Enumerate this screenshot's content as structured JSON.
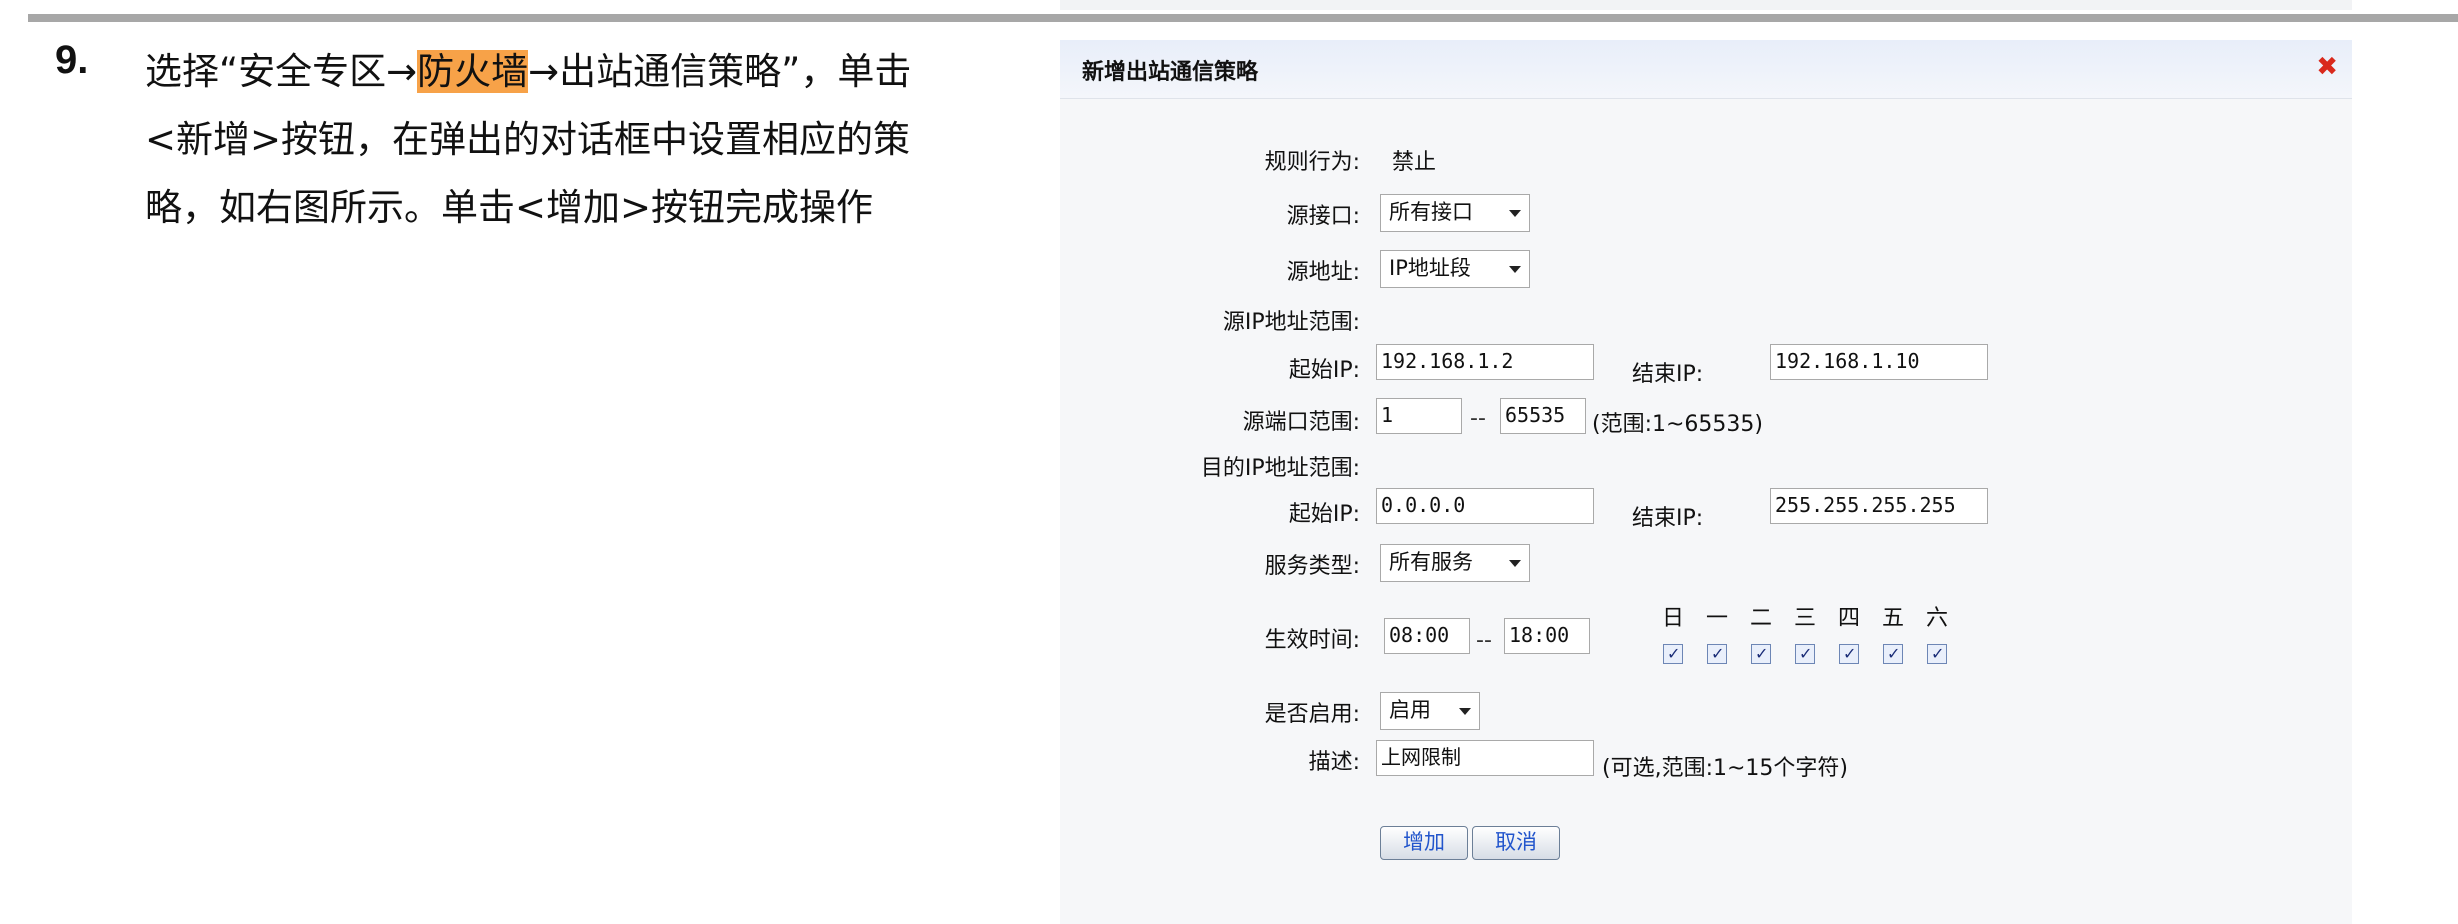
{
  "instruction": {
    "step_number": "9.",
    "line1_before": "选择“安全专区→",
    "line1_highlight": "防火墙",
    "line1_after": "→出站通信策略”，单击",
    "line2": "<新增>按钮，在弹出的对话框中设置相应的策",
    "line3": "略，如右图所示。单击<增加>按钮完成操作"
  },
  "dialog": {
    "title": "新增出站通信策略",
    "close_icon": "close-icon",
    "rule_action": {
      "label": "规则行为:",
      "value": "禁止"
    },
    "src_interface": {
      "label": "源接口:",
      "value": "所有接口"
    },
    "src_address": {
      "label": "源地址:",
      "value": "IP地址段"
    },
    "src_ip_range": {
      "label": "源IP地址范围:",
      "start_label": "起始IP:",
      "start_value": "192.168.1.2",
      "end_label": "结束IP:",
      "end_value": "192.168.1.10"
    },
    "src_port_range": {
      "label": "源端口范围:",
      "from": "1",
      "separator": "--",
      "to": "65535",
      "hint": "(范围:1~65535)"
    },
    "dst_ip_range": {
      "label": "目的IP地址范围:",
      "start_label": "起始IP:",
      "start_value": "0.0.0.0",
      "end_label": "结束IP:",
      "end_value": "255.255.255.255"
    },
    "service_type": {
      "label": "服务类型:",
      "value": "所有服务"
    },
    "effective_time": {
      "label": "生效时间:",
      "from": "08:00",
      "separator": "--",
      "to": "18:00",
      "days": [
        "日",
        "一",
        "二",
        "三",
        "四",
        "五",
        "六"
      ],
      "days_checked": [
        true,
        true,
        true,
        true,
        true,
        true,
        true
      ]
    },
    "enabled": {
      "label": "是否启用:",
      "value": "启用"
    },
    "description": {
      "label": "描述:",
      "value": "上网限制",
      "hint": "(可选,范围:1~15个字符)"
    },
    "buttons": {
      "add": "增加",
      "cancel": "取消"
    }
  }
}
